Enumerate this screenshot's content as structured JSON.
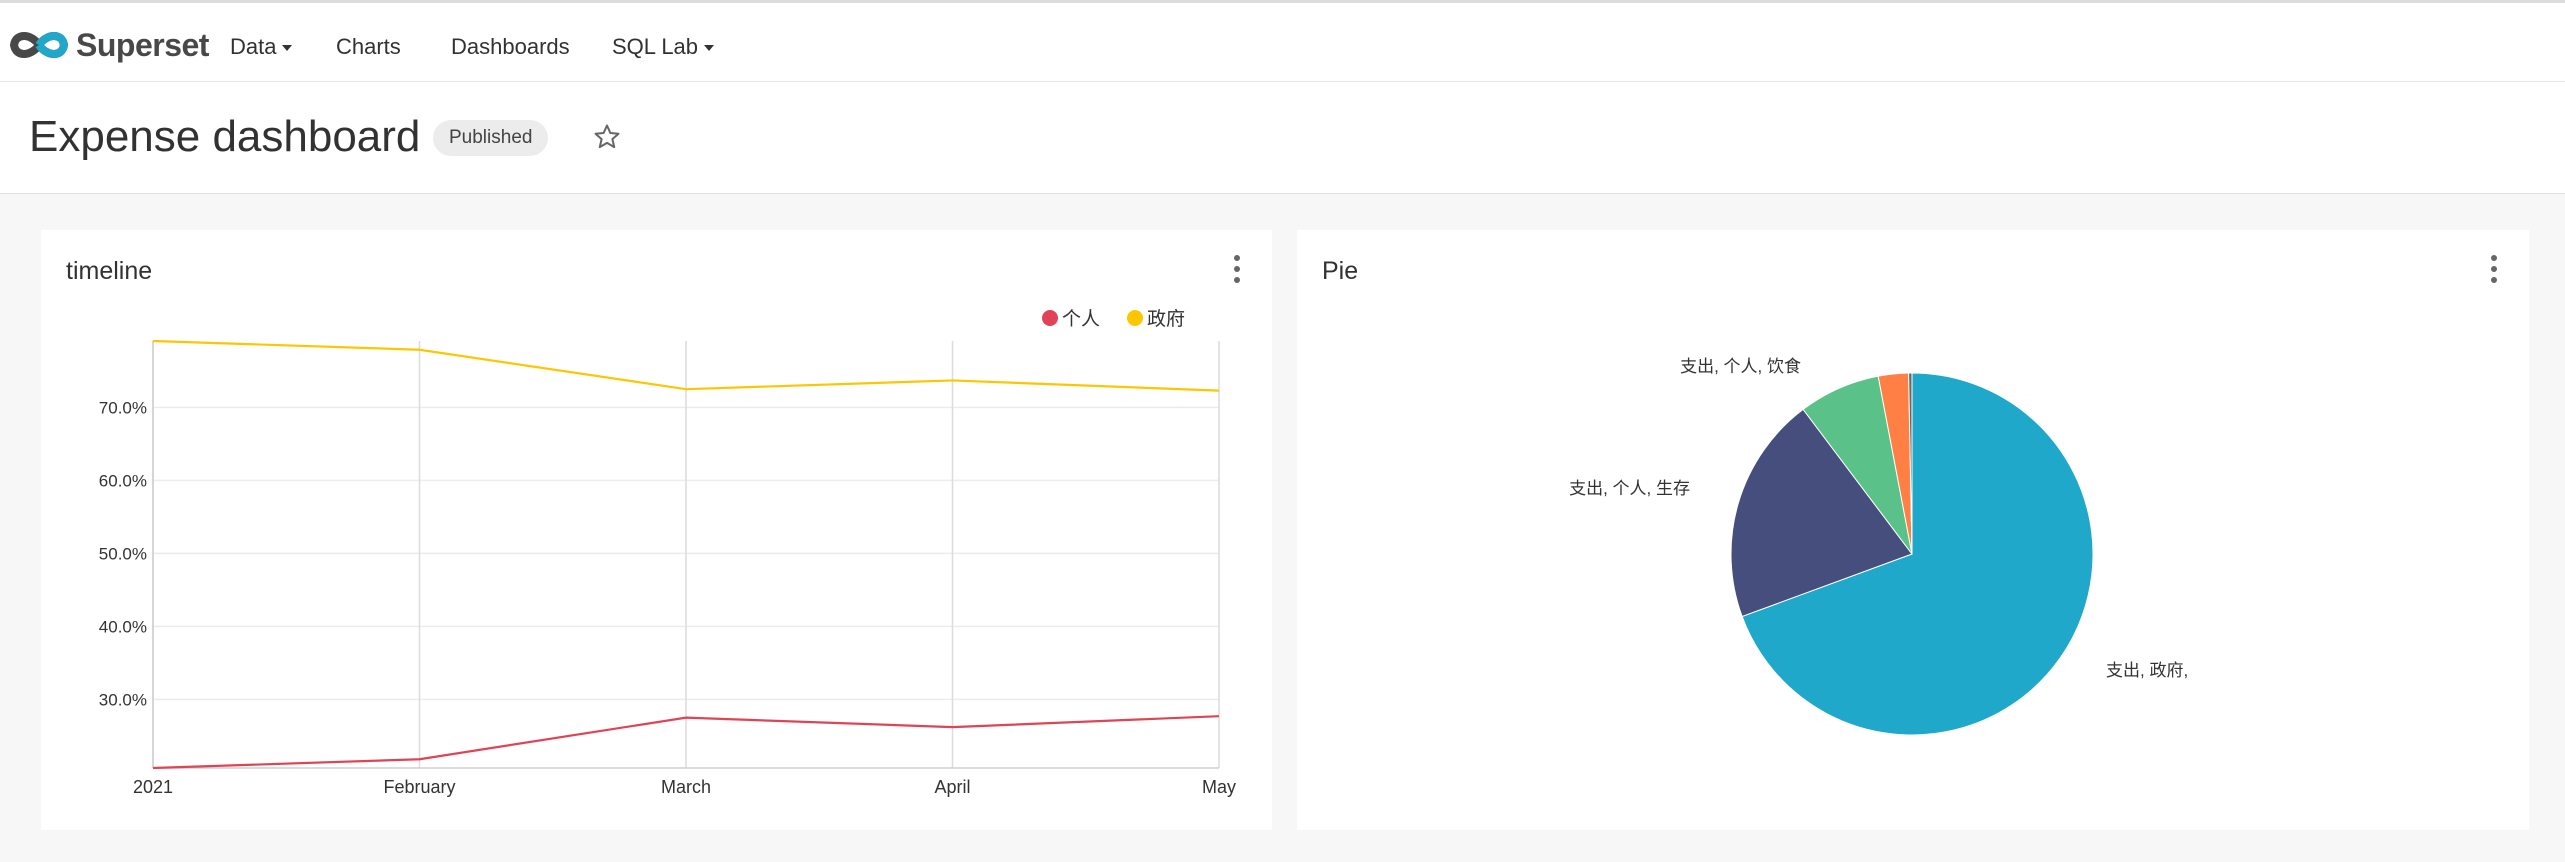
{
  "navbar": {
    "brand": "Superset",
    "items": [
      {
        "label": "Data",
        "dropdown": true
      },
      {
        "label": "Charts",
        "dropdown": false
      },
      {
        "label": "Dashboards",
        "dropdown": false
      },
      {
        "label": "SQL Lab",
        "dropdown": true
      }
    ]
  },
  "dashboard": {
    "title": "Expense dashboard",
    "status": "Published",
    "favorite_icon": "star-icon"
  },
  "colors": {
    "personal": "#e04355",
    "government": "#fcc700",
    "pie_gov": "#1fa8c9",
    "pie_living": "#454e7c",
    "pie_food": "#5ac189",
    "pie_orange": "#ff7f44",
    "pie_other": "#666666"
  },
  "charts": {
    "timeline": {
      "title": "timeline",
      "chart_data": {
        "type": "line",
        "x": [
          "2021",
          "February",
          "March",
          "April",
          "May"
        ],
        "series": [
          {
            "name": "个人",
            "values": [
              20.6,
              21.8,
              27.5,
              26.2,
              27.7
            ]
          },
          {
            "name": "政府",
            "values": [
              79.1,
              77.9,
              72.5,
              73.7,
              72.3
            ]
          }
        ],
        "yticks": [
          "70.0%",
          "60.0%",
          "50.0%",
          "40.0%",
          "30.0%"
        ],
        "ylim": [
          20.6,
          79.1
        ],
        "legend": "top-right",
        "grid": true
      }
    },
    "pie": {
      "title": "Pie",
      "chart_data": {
        "type": "pie",
        "slices": [
          {
            "label": "支出, 政府,",
            "value": 69.6
          },
          {
            "label": "支出, 个人, 生存",
            "value": 20.4
          },
          {
            "label": "支出, 个人, 饮食",
            "value": 7.3
          },
          {
            "label": "",
            "value": 2.7
          },
          {
            "label": "",
            "value": 0.3
          }
        ]
      }
    }
  }
}
